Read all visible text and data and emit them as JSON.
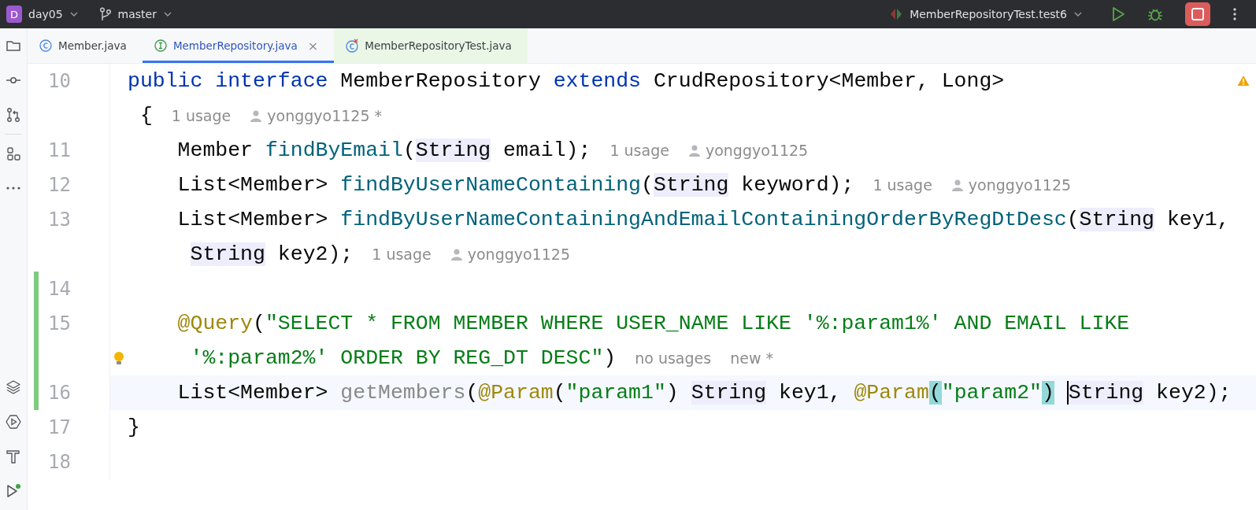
{
  "title_bar": {
    "project_badge": "D",
    "project": "day05",
    "branch": "master",
    "run_config": "MemberRepositoryTest.test6"
  },
  "tool_window_buttons": [
    {
      "kind": "folder"
    },
    {
      "kind": "commit"
    },
    {
      "kind": "pull"
    },
    {
      "kind": "structure"
    },
    {
      "kind": "more"
    },
    {
      "kind": "layers"
    },
    {
      "kind": "services"
    },
    {
      "kind": "build"
    },
    {
      "kind": "run"
    }
  ],
  "tabs": [
    {
      "label": "Member.java",
      "kind": "class",
      "selected": false
    },
    {
      "label": "MemberRepository.java",
      "kind": "interface",
      "selected": true,
      "close": "×"
    },
    {
      "label": "MemberRepositoryTest.java",
      "kind": "test",
      "selected": false
    }
  ],
  "rows": [
    {
      "number": "10",
      "kind": "top",
      "current": false,
      "changed": false,
      "code": [
        {
          "kind": "keyword",
          "text": "public interface"
        },
        {
          "kind": "plain",
          "text": " MemberRepository "
        },
        {
          "kind": "keyword",
          "text": "extends"
        },
        {
          "kind": "plain",
          "text": " CrudRepository<Member, Long>"
        }
      ],
      "hints": [],
      "warning": true
    },
    {
      "kind": "top-wrap",
      "current": false,
      "changed": false,
      "code": [
        {
          "kind": "plain",
          "text": "{"
        }
      ],
      "hints": [
        {
          "kind": "usage",
          "text": "1 usage"
        },
        {
          "kind": "author",
          "text": "yonggyo1125 *"
        }
      ]
    },
    {
      "number": "11",
      "kind": "member",
      "current": false,
      "changed": false,
      "code": [
        {
          "kind": "plain",
          "text": "Member "
        },
        {
          "kind": "method",
          "text": "findByEmail"
        },
        {
          "kind": "plain",
          "text": "("
        },
        {
          "kind": "type",
          "text": "String"
        },
        {
          "kind": "plain",
          "text": " email);"
        }
      ],
      "hints": [
        {
          "kind": "usage",
          "text": "1 usage"
        },
        {
          "kind": "author",
          "text": "yonggyo1125"
        }
      ]
    },
    {
      "number": "12",
      "kind": "member",
      "current": false,
      "changed": false,
      "code": [
        {
          "kind": "plain",
          "text": "List<Member> "
        },
        {
          "kind": "method",
          "text": "findByUserNameContaining"
        },
        {
          "kind": "plain",
          "text": "("
        },
        {
          "kind": "type",
          "text": "String"
        },
        {
          "kind": "plain",
          "text": " keyword);"
        }
      ],
      "hints": [
        {
          "kind": "usage",
          "text": "1 usage"
        },
        {
          "kind": "author",
          "text": "yonggyo1125"
        }
      ]
    },
    {
      "number": "13",
      "kind": "member",
      "current": false,
      "changed": false,
      "code": [
        {
          "kind": "plain",
          "text": "List<Member> "
        },
        {
          "kind": "method",
          "text": "findByUserNameContainingAndEmailContainingOrderByRegDtDesc"
        },
        {
          "kind": "plain",
          "text": "("
        },
        {
          "kind": "type",
          "text": "String"
        },
        {
          "kind": "plain",
          "text": " key1,"
        }
      ],
      "hints": []
    },
    {
      "kind": "member-wrap",
      "current": false,
      "changed": false,
      "code": [
        {
          "kind": "type",
          "text": "String"
        },
        {
          "kind": "plain",
          "text": " key2);"
        }
      ],
      "hints": [
        {
          "kind": "usage",
          "text": "1 usage"
        },
        {
          "kind": "author",
          "text": "yonggyo1125"
        }
      ]
    },
    {
      "number": "14",
      "kind": "member",
      "current": false,
      "changed": true,
      "code": [],
      "hints": []
    },
    {
      "number": "15",
      "kind": "member",
      "current": false,
      "changed": true,
      "code": [
        {
          "kind": "annotation",
          "text": "@Query"
        },
        {
          "kind": "plain",
          "text": "("
        },
        {
          "kind": "string",
          "text": "\"SELECT * FROM MEMBER WHERE USER_NAME LIKE '%:param1%' AND EMAIL LIKE"
        }
      ],
      "hints": []
    },
    {
      "kind": "member-wrap",
      "current": false,
      "changed": true,
      "bulb": true,
      "code": [
        {
          "kind": "string",
          "text": "'%:param2%' ORDER BY REG_DT DESC\""
        },
        {
          "kind": "plain",
          "text": ")"
        }
      ],
      "hints": [
        {
          "kind": "usage",
          "text": "no usages"
        },
        {
          "kind": "author-new",
          "text": "new *"
        }
      ]
    },
    {
      "number": "16",
      "kind": "member",
      "current": true,
      "changed": true,
      "code": [
        {
          "kind": "plain",
          "text": "List<Member> "
        },
        {
          "kind": "unused",
          "text": "getMembers"
        },
        {
          "kind": "plain",
          "text": "("
        },
        {
          "kind": "annotation",
          "text": "@Param"
        },
        {
          "kind": "plain",
          "text": "("
        },
        {
          "kind": "string",
          "text": "\"param1\""
        },
        {
          "kind": "plain",
          "text": ") "
        },
        {
          "kind": "type",
          "text": "String"
        },
        {
          "kind": "plain",
          "text": " key1, "
        },
        {
          "kind": "annotation",
          "text": "@Param"
        },
        {
          "kind": "brace",
          "text": "("
        },
        {
          "kind": "string",
          "text": "\"param2\""
        },
        {
          "kind": "brace",
          "text": ")"
        },
        {
          "kind": "space"
        },
        {
          "kind": "type",
          "text": "String",
          "caret": true
        },
        {
          "kind": "plain",
          "text": " key2);"
        }
      ],
      "hints": []
    },
    {
      "number": "17",
      "kind": "top",
      "current": false,
      "changed": false,
      "code": [
        {
          "kind": "plain",
          "text": "}"
        }
      ],
      "hints": []
    },
    {
      "number": "18",
      "kind": "top",
      "current": false,
      "changed": false,
      "code": [],
      "hints": []
    }
  ]
}
